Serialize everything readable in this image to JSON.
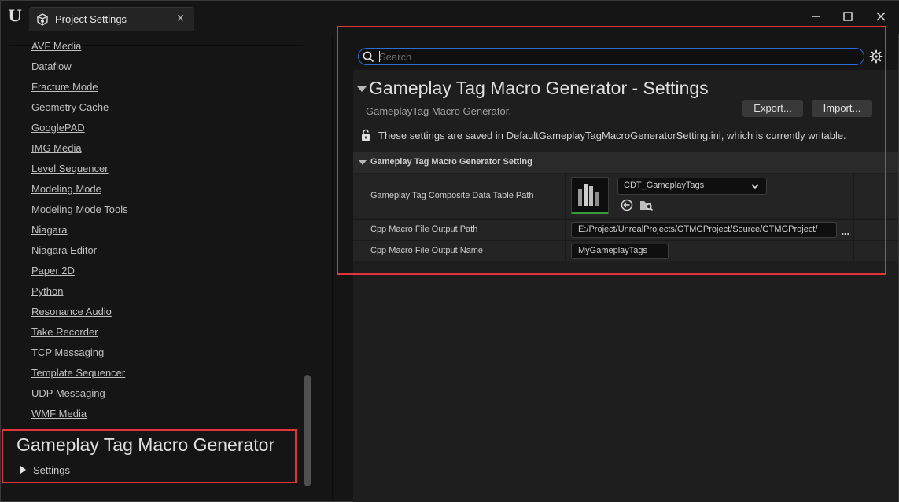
{
  "window": {
    "tab_title": "Project Settings",
    "tab_close": "×",
    "logo_glyph": "U",
    "icons": {
      "logo": "unreal-logo",
      "tab": "settings-cube-icon",
      "minimize": "minimize-icon",
      "maximize": "maximize-icon",
      "close": "close-icon"
    }
  },
  "sidebar": {
    "items": [
      {
        "label": "AVF Media"
      },
      {
        "label": "Dataflow"
      },
      {
        "label": "Fracture Mode"
      },
      {
        "label": "Geometry Cache"
      },
      {
        "label": "GooglePAD"
      },
      {
        "label": "IMG Media"
      },
      {
        "label": "Level Sequencer"
      },
      {
        "label": "Modeling Mode"
      },
      {
        "label": "Modeling Mode Tools"
      },
      {
        "label": "Niagara"
      },
      {
        "label": "Niagara Editor"
      },
      {
        "label": "Paper 2D"
      },
      {
        "label": "Python"
      },
      {
        "label": "Resonance Audio"
      },
      {
        "label": "Take Recorder"
      },
      {
        "label": "TCP Messaging"
      },
      {
        "label": "Template Sequencer"
      },
      {
        "label": "UDP Messaging"
      },
      {
        "label": "WMF Media"
      }
    ],
    "section": {
      "title": "Gameplay Tag Macro Generator",
      "item": "Settings"
    }
  },
  "search": {
    "placeholder": "Search",
    "value": ""
  },
  "details": {
    "title": "Gameplay Tag Macro Generator - Settings",
    "description": "GameplayTag Macro Generator.",
    "export_label": "Export...",
    "import_label": "Import...",
    "writable_notice": "These settings are saved in DefaultGameplayTagMacroGeneratorSetting.ini, which is currently writable.",
    "category": "Gameplay Tag Macro Generator Setting",
    "properties": {
      "data_table": {
        "name": "Gameplay Tag Composite Data Table Path",
        "value": "CDT_GameplayTags"
      },
      "output_path": {
        "name": "Cpp Macro File Output Path",
        "value": "E:/Project/UnrealProjects/GTMGProject/Source/GTMGProject/"
      },
      "output_name": {
        "name": "Cpp Macro File Output Name",
        "value": "MyGameplayTags"
      }
    },
    "more_label": "..."
  },
  "colors": {
    "highlight_border": "#e2343b",
    "search_focus": "#2f6cd6",
    "asset_bar": "#3a9b3a"
  }
}
